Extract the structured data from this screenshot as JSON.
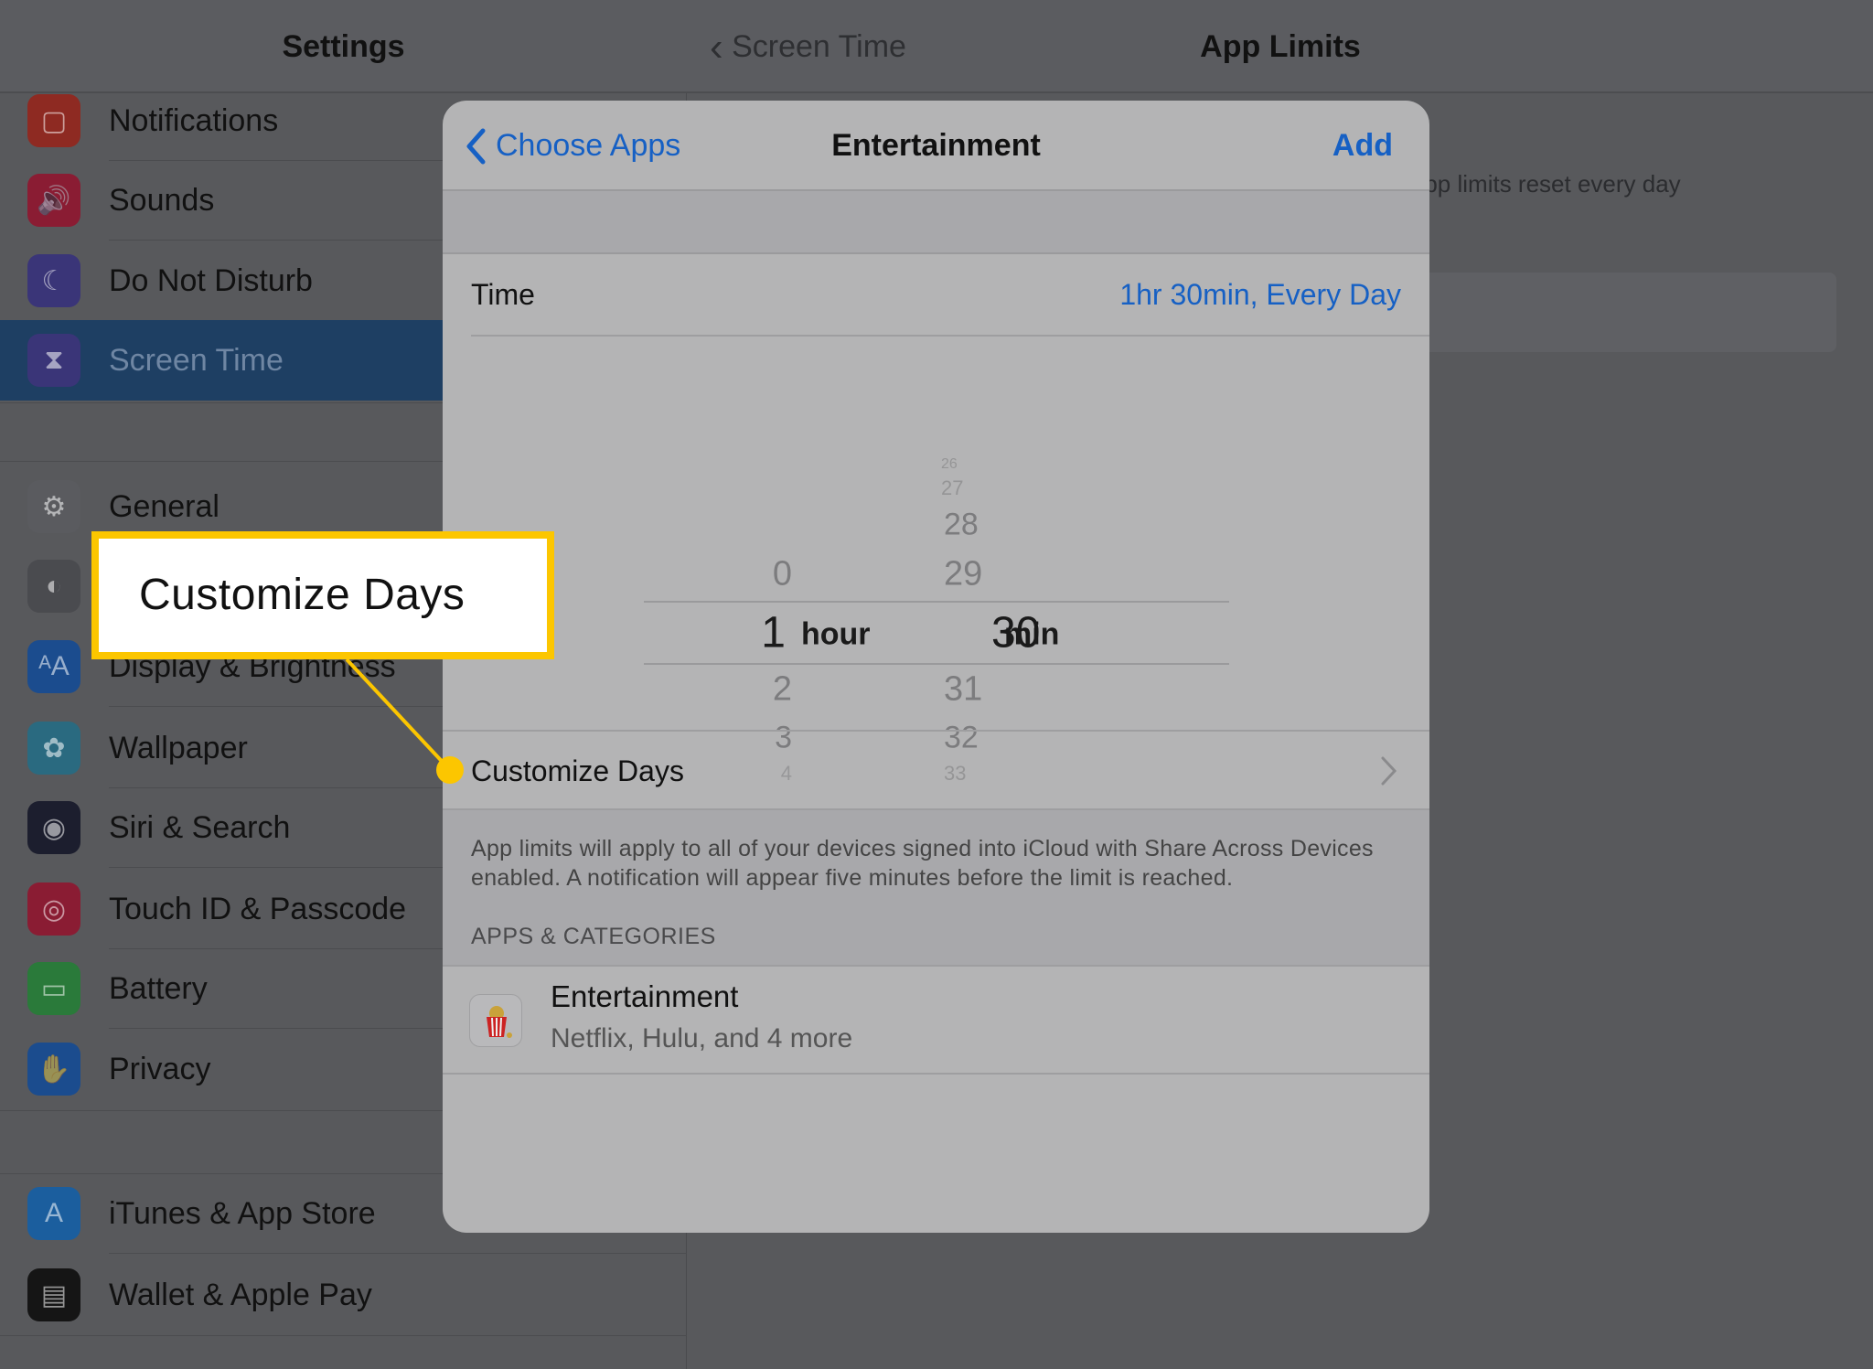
{
  "settings": {
    "title": "Settings",
    "items": [
      {
        "label": "Notifications",
        "icon": "notifications-icon",
        "color": "#8e2a22"
      },
      {
        "label": "Sounds",
        "icon": "sounds-icon",
        "color": "#8a1c33"
      },
      {
        "label": "Do Not Disturb",
        "icon": "moon-icon",
        "color": "#3a3578"
      },
      {
        "label": "Screen Time",
        "icon": "hourglass-icon",
        "color": "#3a3578",
        "selected": true
      },
      {
        "label": "General",
        "icon": "gear-icon",
        "color": "#5a5b5f"
      },
      {
        "label": "",
        "icon": "toggles-icon",
        "color": "#4a4b4f"
      },
      {
        "label": "Display & Brightness",
        "icon": "display-icon",
        "color": "#1b4c8e"
      },
      {
        "label": "Wallpaper",
        "icon": "flower-icon",
        "color": "#2a6a80"
      },
      {
        "label": "Siri & Search",
        "icon": "siri-icon",
        "color": "#1c1e2e"
      },
      {
        "label": "Touch ID & Passcode",
        "icon": "fingerprint-icon",
        "color": "#8a1c33"
      },
      {
        "label": "Battery",
        "icon": "battery-icon",
        "color": "#2a7a3a"
      },
      {
        "label": "Privacy",
        "icon": "hand-icon",
        "color": "#1b4c8e"
      },
      {
        "label": "iTunes & App Store",
        "icon": "app-store-icon",
        "color": "#1b5e9e"
      },
      {
        "label": "Wallet & Apple Pay",
        "icon": "wallet-icon",
        "color": "#151515"
      }
    ]
  },
  "detail": {
    "back_label": "Screen Time",
    "title": "App Limits",
    "note": "App limits reset every day"
  },
  "modal": {
    "back_label": "Choose Apps",
    "title": "Entertainment",
    "add_label": "Add",
    "time_label": "Time",
    "time_value": "1hr 30min, Every Day",
    "picker": {
      "hours": [
        "0",
        "1",
        "2",
        "3",
        "4"
      ],
      "minutes": [
        "26",
        "27",
        "28",
        "29",
        "30",
        "31",
        "32",
        "33"
      ],
      "selected_hour": "1",
      "selected_minute": "30",
      "hour_unit": "hour",
      "minute_unit": "min"
    },
    "customize_days_label": "Customize Days",
    "footer_note": "App limits will apply to all of your devices signed into iCloud with Share Across Devices enabled. A notification will appear five minutes before the limit is reached.",
    "section_header": "APPS & CATEGORIES",
    "category": {
      "name": "Entertainment",
      "subtitle": "Netflix, Hulu, and 4 more",
      "icon": "popcorn-icon"
    }
  },
  "callout": {
    "text": "Customize Days",
    "color": "#fcc600"
  },
  "colors": {
    "accent": "#1660c4",
    "selection": "#1e3f63",
    "highlight": "#fcc600"
  }
}
